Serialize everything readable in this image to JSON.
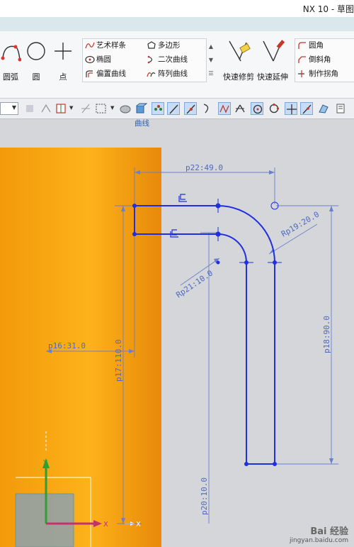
{
  "window": {
    "title": "NX 10 - 草图"
  },
  "ribbon": {
    "big_buttons": [
      {
        "name": "arc-button",
        "label": "圆弧"
      },
      {
        "name": "circle-button",
        "label": "圆"
      },
      {
        "name": "point-button",
        "label": "点"
      }
    ],
    "curve_items": [
      {
        "name": "art-spline",
        "label": "艺术样条"
      },
      {
        "name": "ellipse",
        "label": "椭圆"
      },
      {
        "name": "offset-curve",
        "label": "偏置曲线"
      },
      {
        "name": "polygon",
        "label": "多边形"
      },
      {
        "name": "conic",
        "label": "二次曲线"
      },
      {
        "name": "pattern-curve",
        "label": "阵列曲线"
      }
    ],
    "group_label": "曲线",
    "edit_buttons": [
      {
        "name": "quick-trim-button",
        "label": "快速修剪"
      },
      {
        "name": "quick-extend-button",
        "label": "快速延伸"
      }
    ],
    "corner_items": [
      {
        "name": "fillet",
        "label": "圆角"
      },
      {
        "name": "chamfer",
        "label": "倒斜角"
      },
      {
        "name": "make-corner",
        "label": "制作拐角"
      }
    ]
  },
  "sketch": {
    "dimensions": {
      "p22": "p22:49.0",
      "p19": "Rp19:20.0",
      "p21": "Rp21:10.0",
      "p16": "p16:31.0",
      "p17": "p17:110.0",
      "p18": "p18:90.0",
      "p20": "p20:10.0"
    },
    "axis_x": "X",
    "axis_y": "Y",
    "axis_x2": "X"
  },
  "watermark": {
    "text": "Bai 经验",
    "url": "jingyan.baidu.com"
  },
  "colors": {
    "ribbon_label": "#2c61b4",
    "sketch_blue": "#1f2fe0",
    "dim_blue": "#6a80c8",
    "solid_orange": "#f39c0c"
  }
}
